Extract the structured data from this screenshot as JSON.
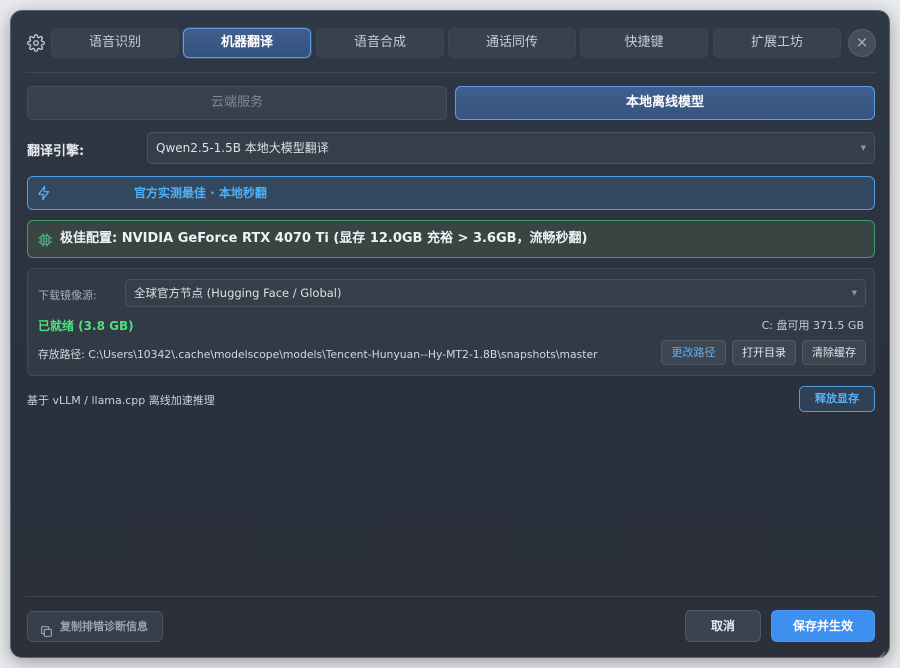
{
  "tabs": [
    {
      "label": "语音识别",
      "active": false
    },
    {
      "label": "机器翻译",
      "active": true
    },
    {
      "label": "语音合成",
      "active": false
    },
    {
      "label": "通话同传",
      "active": false
    },
    {
      "label": "快捷键",
      "active": false
    },
    {
      "label": "扩展工坊",
      "active": false
    }
  ],
  "icons": {
    "settings": "gear-icon",
    "close": "close-icon",
    "lightning": "lightning-icon",
    "chip": "chip-icon",
    "copy": "copy-icon"
  },
  "close_glyph": "×",
  "mode": {
    "cloud_label": "云端服务",
    "local_label": "本地离线模型",
    "selected": "local"
  },
  "engine": {
    "label": "翻译引擎:",
    "value": "Qwen2.5-1.5B 本地大模型翻译"
  },
  "tip_banner": {
    "text": "官方实测最佳 · 本地秒翻"
  },
  "hardware_banner": {
    "text": "极佳配置: NVIDIA GeForce RTX 4070 Ti (显存 12.0GB 充裕 > 3.6GB，流畅秒翻)"
  },
  "model_panel": {
    "mirror_label": "下载镜像源:",
    "mirror_value": "全球官方节点 (Hugging Face / Global)",
    "status": "已就绪 (3.8 GB)",
    "disk_free": "C: 盘可用 371.5 GB",
    "path": "存放路径: C:\\Users\\10342\\.cache\\modelscope\\models\\Tencent-Hunyuan--Hy-MT2-1.8B\\snapshots\\master",
    "change_path_label": "更改路径",
    "open_dir_label": "打开目录",
    "clear_cache_label": "清除缓存"
  },
  "inference_note": "基于 vLLM / llama.cpp 离线加速推理",
  "release_vram_label": "释放显存",
  "footer": {
    "copy_diag_label": "复制排错诊断信息",
    "cancel_label": "取消",
    "save_label": "保存并生效"
  },
  "colors": {
    "accent_blue": "#3d8ff0",
    "status_green": "#4ee07c",
    "tip_blue": "#4cb0f5",
    "hardware_border_green": "#3e9b6a",
    "window_bg": "#2d3440"
  }
}
